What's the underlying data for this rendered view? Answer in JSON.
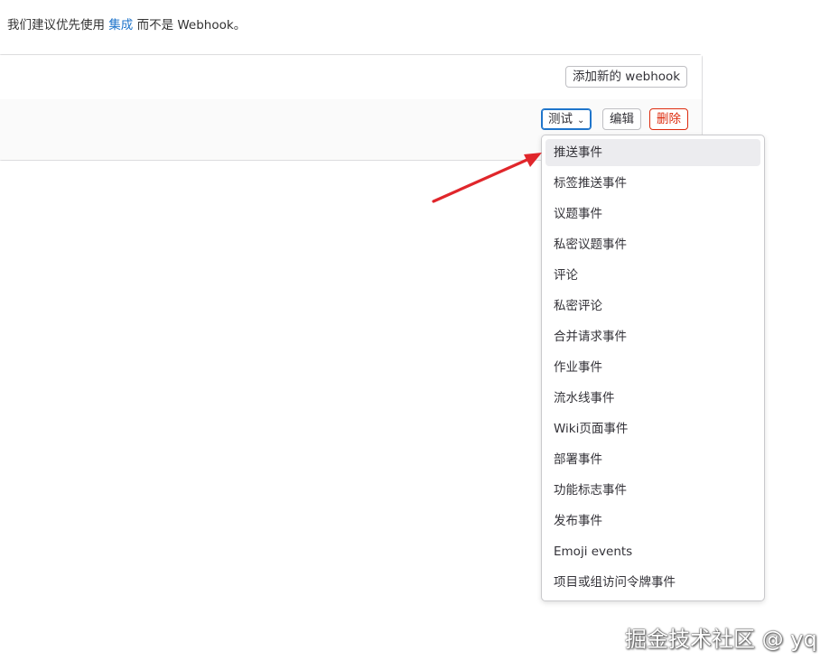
{
  "notice": {
    "prefix": "我们建议优先使用 ",
    "link": "集成",
    "suffix": " 而不是 Webhook。"
  },
  "hooks_card": {
    "add_button": "添加新的 webhook",
    "test_button": "测试",
    "edit_button": "编辑",
    "delete_button": "删除"
  },
  "test_menu": {
    "items": [
      "推送事件",
      "标签推送事件",
      "议题事件",
      "私密议题事件",
      "评论",
      "私密评论",
      "合并请求事件",
      "作业事件",
      "流水线事件",
      "Wiki页面事件",
      "部署事件",
      "功能标志事件",
      "发布事件",
      "Emoji events",
      "项目或组访问令牌事件"
    ]
  },
  "watermark": "掘金技术社区 @ yq",
  "colors": {
    "primary": "#1f75cb",
    "danger": "#dd2b0e",
    "annotation_arrow": "#e0262b"
  }
}
